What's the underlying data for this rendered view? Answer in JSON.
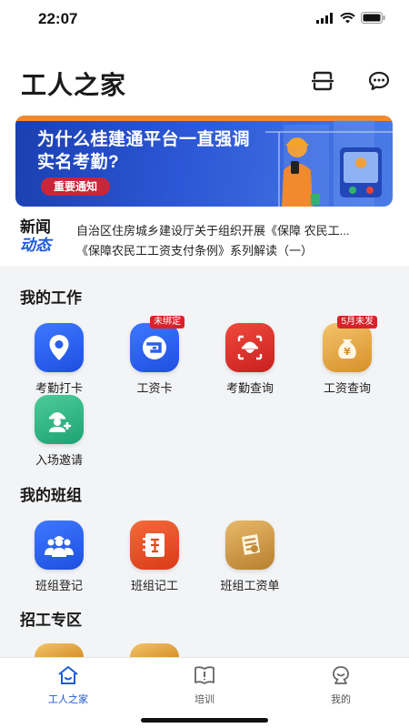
{
  "status": {
    "time": "22:07"
  },
  "header": {
    "title": "工人之家",
    "scan_icon": "scan-icon",
    "message_icon": "chat-bubble-icon"
  },
  "banner": {
    "headline": "为什么桂建通平台一直强调实名考勤?",
    "tag": "重要通知"
  },
  "news": {
    "logo_line1": "新闻",
    "logo_line2": "动态",
    "items": [
      "自治区住房城乡建设厅关于组织开展《保障 农民工...",
      "《保障农民工工资支付条例》系列解读（一）"
    ]
  },
  "my_work": {
    "title": "我的工作",
    "items": [
      {
        "label": "考勤打卡",
        "icon": "location-pin-icon",
        "badge": ""
      },
      {
        "label": "工资卡",
        "icon": "bank-card-icon",
        "badge": "未绑定"
      },
      {
        "label": "考勤查询",
        "icon": "helmet-face-icon",
        "badge": ""
      },
      {
        "label": "工资查询",
        "icon": "money-bag-icon",
        "badge": "5月未发"
      },
      {
        "label": "入场邀请",
        "icon": "worker-add-icon",
        "badge": ""
      }
    ]
  },
  "my_team": {
    "title": "我的班组",
    "items": [
      {
        "label": "班组登记",
        "icon": "team-icon"
      },
      {
        "label": "班组记工",
        "icon": "ledger-icon"
      },
      {
        "label": "班组工资单",
        "icon": "payroll-icon"
      }
    ]
  },
  "recruit": {
    "title": "招工专区"
  },
  "tabbar": {
    "tabs": [
      {
        "label": "工人之家",
        "icon": "home-icon",
        "active": true
      },
      {
        "label": "培训",
        "icon": "book-icon",
        "active": false
      },
      {
        "label": "我的",
        "icon": "profile-icon",
        "active": false
      }
    ]
  },
  "colors": {
    "accent": "#1c5bd9",
    "badge": "#d8232a",
    "banner": "#2c57d6"
  }
}
